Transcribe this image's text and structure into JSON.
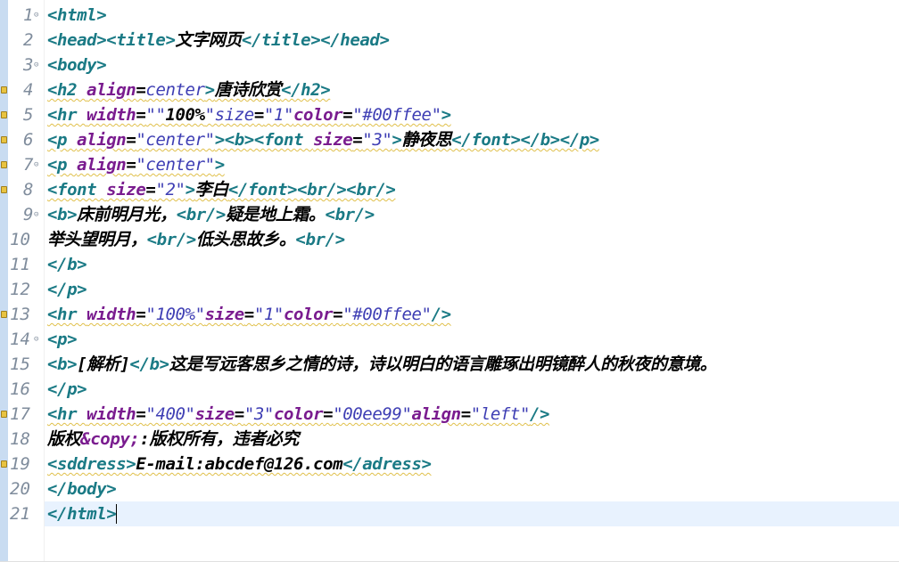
{
  "editor": {
    "lines": [
      {
        "num": "1",
        "fold": true,
        "warn": false,
        "segs": [
          [
            "tg",
            "<html>"
          ]
        ]
      },
      {
        "num": "2",
        "fold": false,
        "warn": false,
        "segs": [
          [
            "tg",
            "<head><title>"
          ],
          [
            "tx",
            "文字网页"
          ],
          [
            "tg",
            "</title></head>"
          ]
        ]
      },
      {
        "num": "3",
        "fold": true,
        "warn": false,
        "segs": [
          [
            "tg",
            "<body>"
          ]
        ]
      },
      {
        "num": "4",
        "fold": false,
        "warn": true,
        "segs": [
          [
            "tg",
            "<h2 "
          ],
          [
            "at",
            "align"
          ],
          [
            "tx",
            "="
          ],
          [
            "st",
            "center"
          ],
          [
            "tg",
            ">"
          ],
          [
            "tx",
            "唐诗欣赏"
          ],
          [
            "tg",
            "</h2>"
          ]
        ]
      },
      {
        "num": "5",
        "fold": false,
        "warn": true,
        "segs": [
          [
            "tg",
            "<hr "
          ],
          [
            "at",
            "width"
          ],
          [
            "tx",
            "="
          ],
          [
            "st",
            "\"\""
          ],
          [
            "tx",
            "100%"
          ],
          [
            "st",
            "\"size"
          ],
          [
            "tx",
            "="
          ],
          [
            "st",
            "\"1\""
          ],
          [
            "at",
            "color"
          ],
          [
            "tx",
            "="
          ],
          [
            "st",
            "\"#00ffee\""
          ],
          [
            "tg",
            ">"
          ]
        ]
      },
      {
        "num": "6",
        "fold": false,
        "warn": true,
        "segs": [
          [
            "tg",
            "<p "
          ],
          [
            "at",
            "align"
          ],
          [
            "tx",
            "="
          ],
          [
            "st",
            "\"center\""
          ],
          [
            "tg",
            "><b><font "
          ],
          [
            "at",
            "size"
          ],
          [
            "tx",
            "="
          ],
          [
            "st",
            "\"3\""
          ],
          [
            "tg",
            ">"
          ],
          [
            "tx",
            "静夜思"
          ],
          [
            "tg",
            "</font></b></p>"
          ]
        ]
      },
      {
        "num": "7",
        "fold": true,
        "warn": true,
        "segs": [
          [
            "tg",
            "<p "
          ],
          [
            "at",
            "align"
          ],
          [
            "tx",
            "="
          ],
          [
            "st",
            "\"center\""
          ],
          [
            "tg",
            ">"
          ]
        ]
      },
      {
        "num": "8",
        "fold": false,
        "warn": true,
        "segs": [
          [
            "tg",
            "<font "
          ],
          [
            "at",
            "size"
          ],
          [
            "tx",
            "="
          ],
          [
            "st",
            "\"2\""
          ],
          [
            "tg",
            ">"
          ],
          [
            "tx",
            "李白"
          ],
          [
            "tg",
            "</font><br/><br/>"
          ]
        ]
      },
      {
        "num": "9",
        "fold": true,
        "warn": false,
        "segs": [
          [
            "tg",
            "<b>"
          ],
          [
            "tx",
            "床前明月光，"
          ],
          [
            "tg",
            "<br/>"
          ],
          [
            "tx",
            "疑是地上霜。"
          ],
          [
            "tg",
            "<br/>"
          ]
        ]
      },
      {
        "num": "10",
        "fold": false,
        "warn": false,
        "segs": [
          [
            "tx",
            "举头望明月，"
          ],
          [
            "tg",
            "<br/>"
          ],
          [
            "tx",
            "低头思故乡。"
          ],
          [
            "tg",
            "<br/>"
          ]
        ]
      },
      {
        "num": "11",
        "fold": false,
        "warn": false,
        "segs": [
          [
            "tg",
            "</b>"
          ]
        ]
      },
      {
        "num": "12",
        "fold": false,
        "warn": false,
        "segs": [
          [
            "tg",
            "</p>"
          ]
        ]
      },
      {
        "num": "13",
        "fold": false,
        "warn": true,
        "segs": [
          [
            "tg",
            "<hr "
          ],
          [
            "at",
            "width"
          ],
          [
            "tx",
            "="
          ],
          [
            "st",
            "\"100%\""
          ],
          [
            "at",
            "size"
          ],
          [
            "tx",
            "="
          ],
          [
            "st",
            "\"1\""
          ],
          [
            "at",
            "color"
          ],
          [
            "tx",
            "="
          ],
          [
            "st",
            "\"#00ffee\""
          ],
          [
            "tg",
            "/>"
          ]
        ]
      },
      {
        "num": "14",
        "fold": true,
        "warn": false,
        "segs": [
          [
            "tg",
            "<p>"
          ]
        ]
      },
      {
        "num": "15",
        "fold": false,
        "warn": false,
        "segs": [
          [
            "tg",
            "<b>"
          ],
          [
            "tx",
            "[解析]"
          ],
          [
            "tg",
            "</b>"
          ],
          [
            "tx",
            "这是写远客思乡之情的诗，诗以明白的语言雕琢出明镜醉人的秋夜的意境。"
          ]
        ]
      },
      {
        "num": "16",
        "fold": false,
        "warn": false,
        "segs": [
          [
            "tg",
            "</p>"
          ]
        ]
      },
      {
        "num": "17",
        "fold": false,
        "warn": true,
        "segs": [
          [
            "tg",
            "<hr "
          ],
          [
            "at",
            "width"
          ],
          [
            "tx",
            "="
          ],
          [
            "st",
            "\"400\""
          ],
          [
            "at",
            "size"
          ],
          [
            "tx",
            "="
          ],
          [
            "st",
            "\"3\""
          ],
          [
            "at",
            "color"
          ],
          [
            "tx",
            "="
          ],
          [
            "st",
            "\"00ee99\""
          ],
          [
            "at",
            "align"
          ],
          [
            "tx",
            "="
          ],
          [
            "st",
            "\"left\""
          ],
          [
            "tg",
            "/>"
          ]
        ]
      },
      {
        "num": "18",
        "fold": false,
        "warn": false,
        "segs": [
          [
            "tx",
            "版权"
          ],
          [
            "en",
            "&copy;"
          ],
          [
            "tx",
            ":版权所有，违者必究"
          ]
        ]
      },
      {
        "num": "19",
        "fold": false,
        "warn": true,
        "segs": [
          [
            "tg",
            "<sddress>"
          ],
          [
            "tx",
            "E-mail:abcdef@126.com"
          ],
          [
            "tg",
            "</adress>"
          ]
        ]
      },
      {
        "num": "20",
        "fold": false,
        "warn": false,
        "segs": [
          [
            "tg",
            "</body>"
          ]
        ]
      },
      {
        "num": "21",
        "fold": false,
        "warn": false,
        "current": true,
        "segs": [
          [
            "tg",
            "</html>"
          ]
        ]
      }
    ]
  }
}
